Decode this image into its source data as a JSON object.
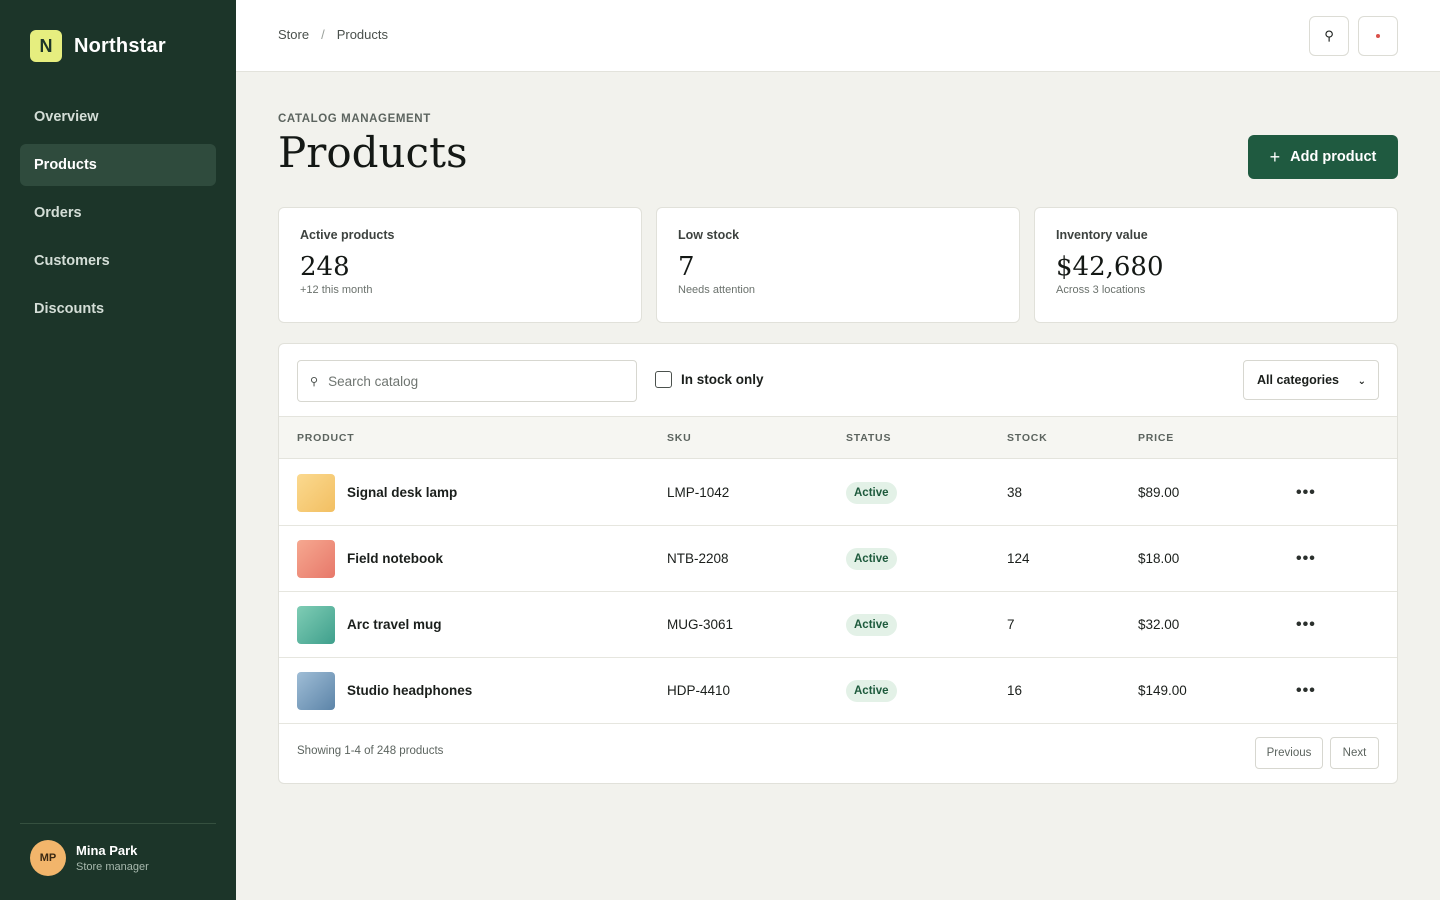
{
  "sidebar": {
    "brand_mark": "N",
    "brand_name": "Northstar",
    "items": [
      {
        "label": "Overview",
        "active": false
      },
      {
        "label": "Products",
        "active": true
      },
      {
        "label": "Orders",
        "active": false
      },
      {
        "label": "Customers",
        "active": false
      },
      {
        "label": "Discounts",
        "active": false
      }
    ],
    "user": {
      "initials": "MP",
      "name": "Mina Park",
      "role": "Store manager"
    }
  },
  "topbar": {
    "breadcrumb": [
      "Store",
      "Products"
    ],
    "breadcrumb_separator": "/",
    "search_icon": "search-icon",
    "notification_icon": "notification-dot-icon"
  },
  "header": {
    "eyebrow": "CATALOG MANAGEMENT",
    "title": "Products",
    "add_button_icon": "+",
    "add_button_label": "Add product"
  },
  "stats": [
    {
      "label": "Active products",
      "value": "248",
      "sub": "+12 this month"
    },
    {
      "label": "Low stock",
      "value": "7",
      "sub": "Needs attention"
    },
    {
      "label": "Inventory value",
      "value": "$42,680",
      "sub": "Across 3 locations"
    }
  ],
  "filters": {
    "search_placeholder": "Search catalog",
    "search_value": "",
    "in_stock_label": "In stock only",
    "in_stock_checked": false,
    "category_selected": "All categories"
  },
  "table": {
    "columns": [
      "PRODUCT",
      "SKU",
      "STATUS",
      "STOCK",
      "PRICE"
    ],
    "rows": [
      {
        "name": "Signal desk lamp",
        "sku": "LMP-1042",
        "status": "Active",
        "stock": "38",
        "price": "$89.00",
        "thumb_from": "#fbd98f",
        "thumb_to": "#f2bf62"
      },
      {
        "name": "Field notebook",
        "sku": "NTB-2208",
        "status": "Active",
        "stock": "124",
        "price": "$18.00",
        "thumb_from": "#f6a890",
        "thumb_to": "#e7786a"
      },
      {
        "name": "Arc travel mug",
        "sku": "MUG-3061",
        "status": "Active",
        "stock": "7",
        "price": "$32.00",
        "thumb_from": "#7fcdb5",
        "thumb_to": "#3f9f8c"
      },
      {
        "name": "Studio headphones",
        "sku": "HDP-4410",
        "status": "Active",
        "stock": "16",
        "price": "$149.00",
        "thumb_from": "#9fbdd6",
        "thumb_to": "#5c84a8"
      }
    ],
    "row_action": "•••"
  },
  "footer": {
    "showing": "Showing 1-4 of 248 products",
    "previous": "Previous",
    "next": "Next"
  },
  "colors": {
    "sidebar_bg": "#1c3529",
    "accent": "#1f5a40",
    "brand_mark": "#e6ee7f",
    "active_badge_bg": "#e3f1e7",
    "page_bg": "#f2f2ed"
  }
}
